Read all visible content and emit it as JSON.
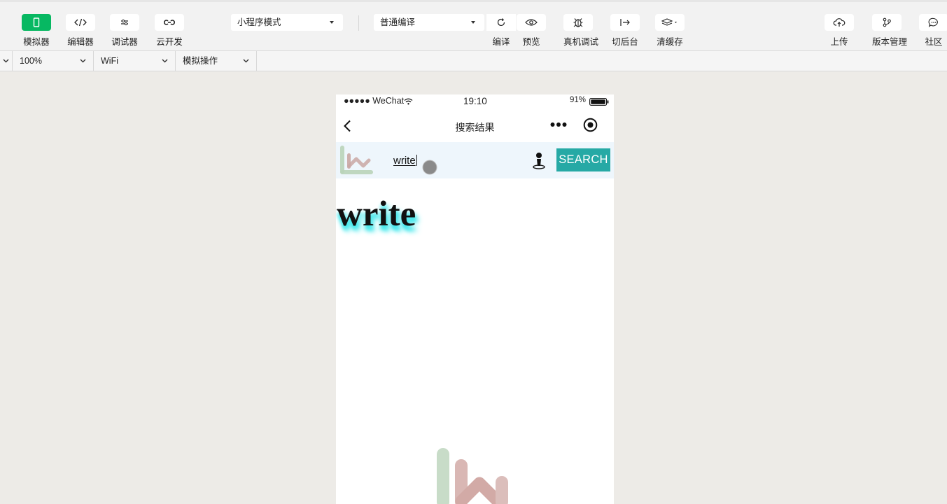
{
  "toolbar": {
    "left_tools": [
      {
        "label": "模拟器",
        "icon": "phone-icon",
        "active": true
      },
      {
        "label": "编辑器",
        "icon": "code-icon",
        "active": false
      },
      {
        "label": "调试器",
        "icon": "sliders-icon",
        "active": false
      },
      {
        "label": "云开发",
        "icon": "cloud-link-icon",
        "active": false
      }
    ],
    "mode_select": {
      "value": "小程序模式"
    },
    "compile_select": {
      "value": "普通编译"
    },
    "compile_label": "编译",
    "preview_label": "预览",
    "device_debug_label": "真机调试",
    "background_label": "切后台",
    "clear_cache_label": "清缓存",
    "upload_label": "上传",
    "version_label": "版本管理",
    "community_label": "社区"
  },
  "subbar": {
    "zoom": "100%",
    "network": "WiFi",
    "operation": "模拟操作"
  },
  "phone": {
    "status": {
      "carrier": "●●●●● WeChat",
      "time": "19:10",
      "battery": "91%"
    },
    "nav": {
      "title": "搜索结果"
    },
    "search": {
      "query": "write",
      "button_label": "SEARCH"
    },
    "result": {
      "word": "write"
    },
    "colors": {
      "search_button": "#26a9a5",
      "search_bar_bg": "#eef6fc",
      "active_tool": "#07b862"
    }
  }
}
